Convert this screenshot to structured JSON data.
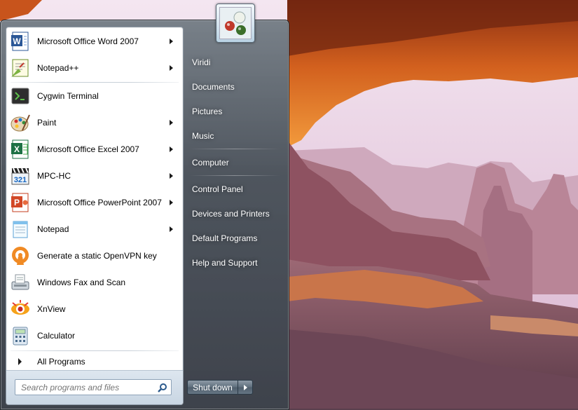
{
  "start_menu": {
    "programs": [
      {
        "label": "Microsoft Office Word 2007",
        "icon": "word-icon",
        "has_arrow": true
      },
      {
        "label": "Notepad++",
        "icon": "notepadplusplus-icon",
        "has_arrow": true
      },
      {
        "label": "Cygwin Terminal",
        "icon": "terminal-icon",
        "has_arrow": false
      },
      {
        "label": "Paint",
        "icon": "paint-icon",
        "has_arrow": true
      },
      {
        "label": "Microsoft Office Excel 2007",
        "icon": "excel-icon",
        "has_arrow": true
      },
      {
        "label": "MPC-HC",
        "icon": "mpc-hc-icon",
        "has_arrow": true
      },
      {
        "label": "Microsoft Office PowerPoint 2007",
        "icon": "powerpoint-icon",
        "has_arrow": true
      },
      {
        "label": "Notepad",
        "icon": "notepad-icon",
        "has_arrow": true
      },
      {
        "label": "Generate a static OpenVPN key",
        "icon": "openvpn-icon",
        "has_arrow": false
      },
      {
        "label": "Windows Fax and Scan",
        "icon": "fax-icon",
        "has_arrow": false
      },
      {
        "label": "XnView",
        "icon": "xnview-icon",
        "has_arrow": false
      },
      {
        "label": "Calculator",
        "icon": "calculator-icon",
        "has_arrow": false
      }
    ],
    "all_programs_label": "All Programs",
    "search": {
      "placeholder": "Search programs and files"
    },
    "right_items": [
      {
        "label": "Viridi"
      },
      {
        "label": "Documents"
      },
      {
        "label": "Pictures"
      },
      {
        "label": "Music"
      },
      {
        "label": "Computer"
      },
      {
        "label": "Control Panel"
      },
      {
        "label": "Devices and Printers"
      },
      {
        "label": "Default Programs"
      },
      {
        "label": "Help and Support"
      }
    ],
    "shutdown_label": "Shut down"
  },
  "colors": {
    "menu_glass": "#4a5560",
    "pane_white": "#ffffff",
    "search_band": "#d5dfe9",
    "rock_orange": "#c8541c",
    "sky_pink": "#e8cfe0"
  }
}
